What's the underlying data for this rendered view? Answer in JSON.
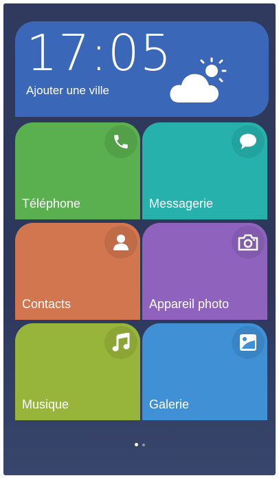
{
  "clock": {
    "time": "17:05",
    "city_prompt": "Ajouter une ville",
    "weather_icon": "partly-cloudy-icon"
  },
  "tiles": [
    {
      "label": "Téléphone",
      "icon": "phone-icon",
      "color": "#5aaf4f"
    },
    {
      "label": "Messagerie",
      "icon": "message-icon",
      "color": "#27b1ad"
    },
    {
      "label": "Contacts",
      "icon": "contact-icon",
      "color": "#d2764f"
    },
    {
      "label": "Appareil photo",
      "icon": "camera-icon",
      "color": "#8f63bd"
    },
    {
      "label": "Musique",
      "icon": "music-note-icon",
      "color": "#97b53a"
    },
    {
      "label": "Galerie",
      "icon": "gallery-icon",
      "color": "#3f90d5"
    }
  ],
  "pager": {
    "pages": 2,
    "current": 1
  }
}
